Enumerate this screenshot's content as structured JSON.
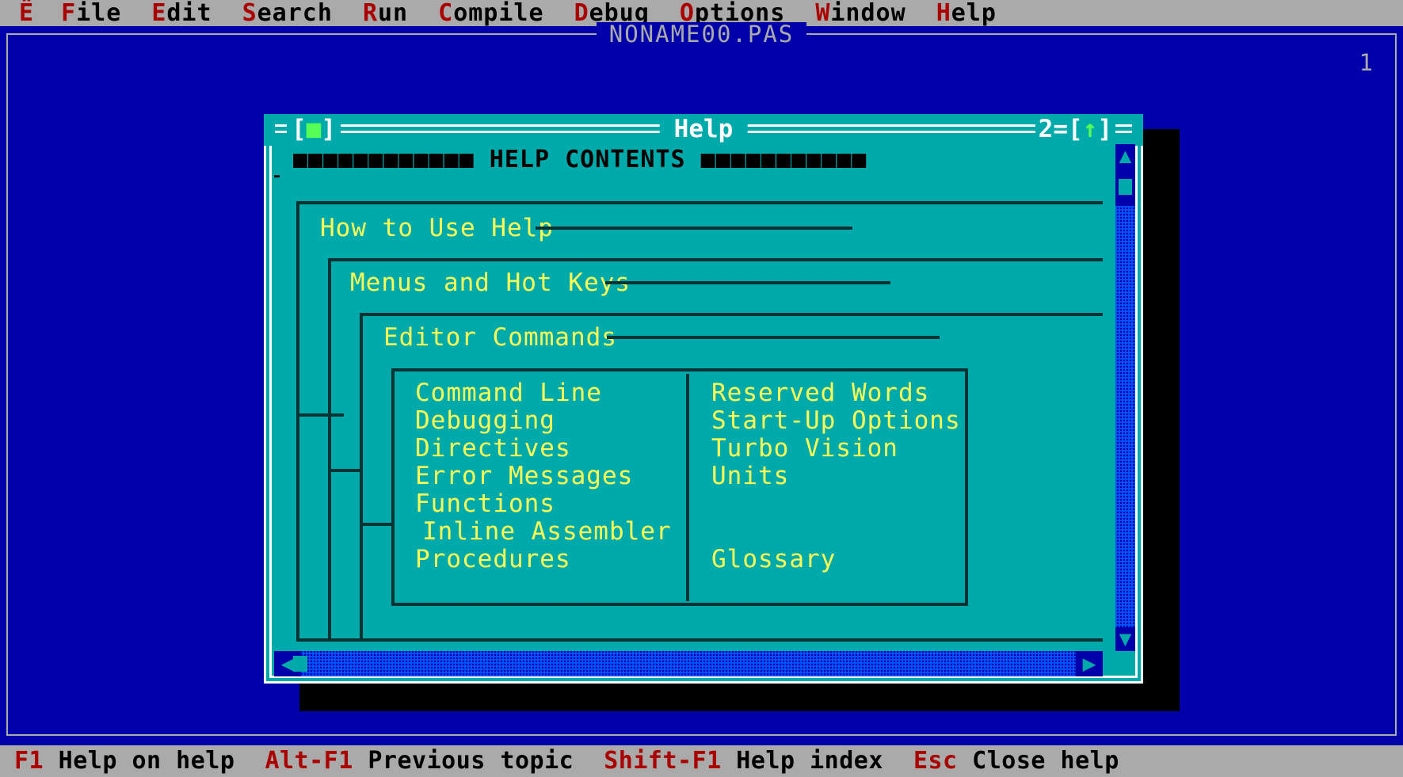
{
  "menubar": {
    "items": [
      {
        "name": "system-menu",
        "hotkey": "Ë",
        "rest": ""
      },
      {
        "name": "file",
        "hotkey": "F",
        "rest": "ile"
      },
      {
        "name": "edit",
        "hotkey": "E",
        "rest": "dit"
      },
      {
        "name": "search",
        "hotkey": "S",
        "rest": "earch"
      },
      {
        "name": "run",
        "hotkey": "R",
        "rest": "un"
      },
      {
        "name": "compile",
        "hotkey": "C",
        "rest": "ompile"
      },
      {
        "name": "debug",
        "hotkey": "D",
        "rest": "ebug"
      },
      {
        "name": "options",
        "hotkey": "O",
        "rest": "ptions"
      },
      {
        "name": "window",
        "hotkey": "W",
        "rest": "indow"
      },
      {
        "name": "help",
        "hotkey": "H",
        "rest": "elp"
      }
    ]
  },
  "editor_window": {
    "title": "NONAME00.PAS",
    "number": "1"
  },
  "help_window": {
    "title": "Help",
    "close_box_left": "[",
    "close_box_square": "■",
    "close_box_right": "]",
    "zoom_number": "2=",
    "zoom_left": "[",
    "zoom_arrow": "↑",
    "zoom_right": "]",
    "cursor": "_",
    "contents_heading": "■■■■■■■■■■■■ HELP CONTENTS ■■■■■■■■■■■",
    "tree": [
      {
        "label": "How to Use Help"
      },
      {
        "label": "Menus and Hot Keys"
      },
      {
        "label": "Editor Commands"
      }
    ],
    "topics_left": [
      "Command Line",
      "Debugging",
      "Directives",
      "Error Messages",
      "Functions",
      "Inline Assembler",
      "Procedures"
    ],
    "topics_right": [
      "Reserved Words",
      "Start-Up Options",
      "Turbo Vision",
      "Units",
      "",
      "",
      "Glossary"
    ],
    "scrollbar": {
      "up_arrow": "▲",
      "down_arrow": "▼",
      "left_arrow": "◀",
      "right_arrow": "▶"
    }
  },
  "statusbar": {
    "items": [
      {
        "key": "F1",
        "label": " Help on help"
      },
      {
        "key": "Alt-F1",
        "label": " Previous topic"
      },
      {
        "key": "Shift-F1",
        "label": " Help index"
      },
      {
        "key": "Esc",
        "label": " Close help"
      }
    ]
  },
  "colors": {
    "desktop": "#0000AA",
    "menubar": "#AAAAAA",
    "help_bg": "#00AAAA",
    "highlight_yellow": "#FFFF55",
    "hotkey_red": "#AA0000",
    "accent_green": "#55FF55",
    "frame_dark": "#003333"
  }
}
